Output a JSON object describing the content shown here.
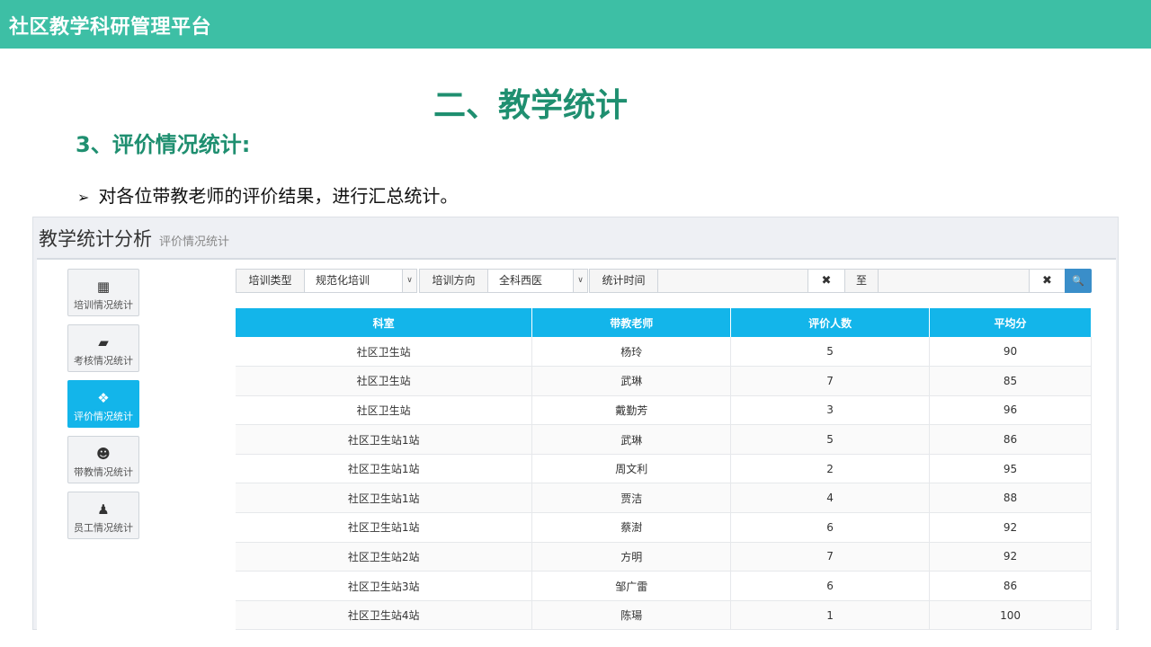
{
  "topbar": {
    "brand": "社区教学科研管理平台"
  },
  "slide": {
    "title": "二、教学统计",
    "section": "3、评价情况统计:",
    "bullet": "对各位带教老师的评价结果，进行汇总统计。",
    "bullet_marker": "➢"
  },
  "app": {
    "title": "教学统计分析",
    "subtitle": "评价情况统计"
  },
  "sidebar": {
    "items": [
      {
        "label": "培训情况统计",
        "icon": "table-icon",
        "glyph": "▦",
        "active": false
      },
      {
        "label": "考核情况统计",
        "icon": "book-icon",
        "glyph": "▰",
        "active": false
      },
      {
        "label": "评价情况统计",
        "icon": "cubes-icon",
        "glyph": "❖",
        "active": true
      },
      {
        "label": "带教情况统计",
        "icon": "users-icon",
        "glyph": "☻",
        "active": false
      },
      {
        "label": "员工情况统计",
        "icon": "user-tie-icon",
        "glyph": "♟",
        "active": false
      }
    ]
  },
  "filters": {
    "training_type_label": "培训类型",
    "training_type_value": "规范化培训",
    "direction_label": "培训方向",
    "direction_value": "全科西医",
    "time_label": "统计时间",
    "start_value": "",
    "to_label": "至",
    "end_value": "",
    "clear_glyph": "✖",
    "caret_glyph": "∨",
    "search_glyph": "🔍"
  },
  "table": {
    "headers": [
      "科室",
      "带教老师",
      "评价人数",
      "平均分"
    ],
    "rows": [
      [
        "社区卫生站",
        "杨玲",
        "5",
        "90"
      ],
      [
        "社区卫生站",
        "武琳",
        "7",
        "85"
      ],
      [
        "社区卫生站",
        "戴勤芳",
        "3",
        "96"
      ],
      [
        "社区卫生站1站",
        "武琳",
        "5",
        "86"
      ],
      [
        "社区卫生站1站",
        "周文利",
        "2",
        "95"
      ],
      [
        "社区卫生站1站",
        "贾洁",
        "4",
        "88"
      ],
      [
        "社区卫生站1站",
        "蔡澍",
        "6",
        "92"
      ],
      [
        "社区卫生站2站",
        "方明",
        "7",
        "92"
      ],
      [
        "社区卫生站3站",
        "邹广雷",
        "6",
        "86"
      ],
      [
        "社区卫生站4站",
        "陈瑒",
        "1",
        "100"
      ]
    ]
  },
  "colors": {
    "topbar": "#3dbfa5",
    "title_green": "#1f8f70",
    "accent_blue": "#13b5ea",
    "search_blue": "#3a8ec9"
  }
}
